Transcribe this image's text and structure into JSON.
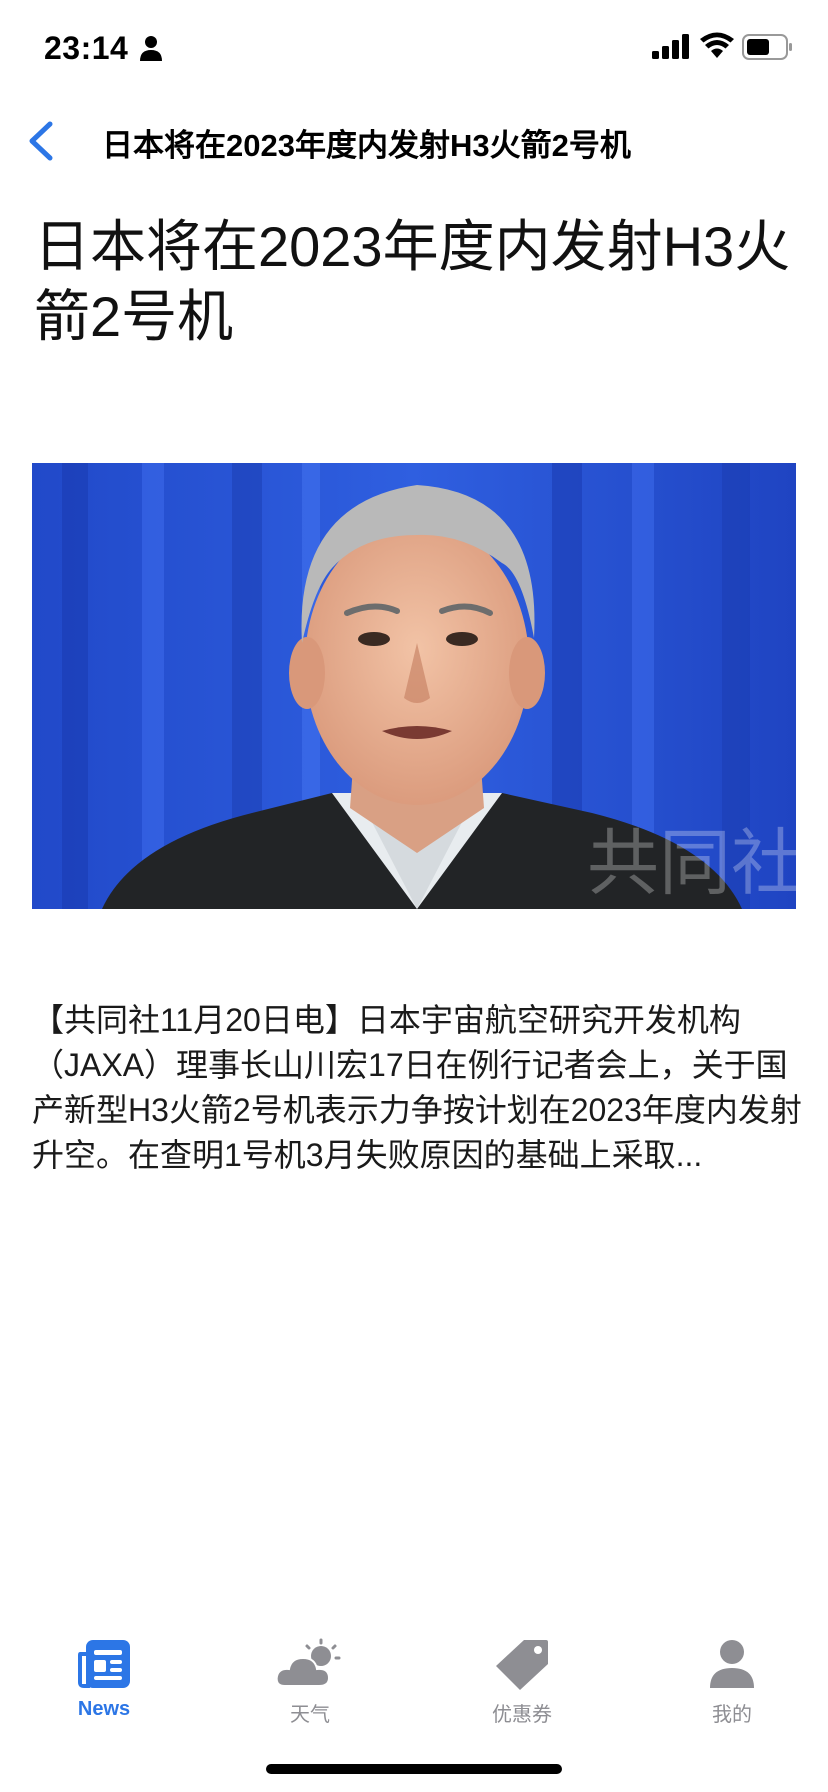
{
  "status_bar": {
    "time": "23:14"
  },
  "nav": {
    "title": "日本将在2023年度内发射H3火箭2号机"
  },
  "article": {
    "headline": "日本将在2023年度内发射H3火箭2号机",
    "image_watermark": "共同社",
    "body": "【共同社11月20日电】日本宇宙航空研究开发机构（JAXA）理事长山川宏17日在例行记者会上，关于国产新型H3火箭2号机表示力争按计划在2023年度内发射升空。在查明1号机3月失败原因的基础上采取..."
  },
  "tabs": [
    {
      "label": "News",
      "icon": "newspaper-icon",
      "active": true
    },
    {
      "label": "天气",
      "icon": "weather-icon",
      "active": false
    },
    {
      "label": "优惠券",
      "icon": "tag-icon",
      "active": false
    },
    {
      "label": "我的",
      "icon": "person-icon",
      "active": false
    }
  ],
  "colors": {
    "accent": "#2c76e6",
    "inactive": "#8e8e93",
    "image_backdrop": "#1f46c8"
  }
}
